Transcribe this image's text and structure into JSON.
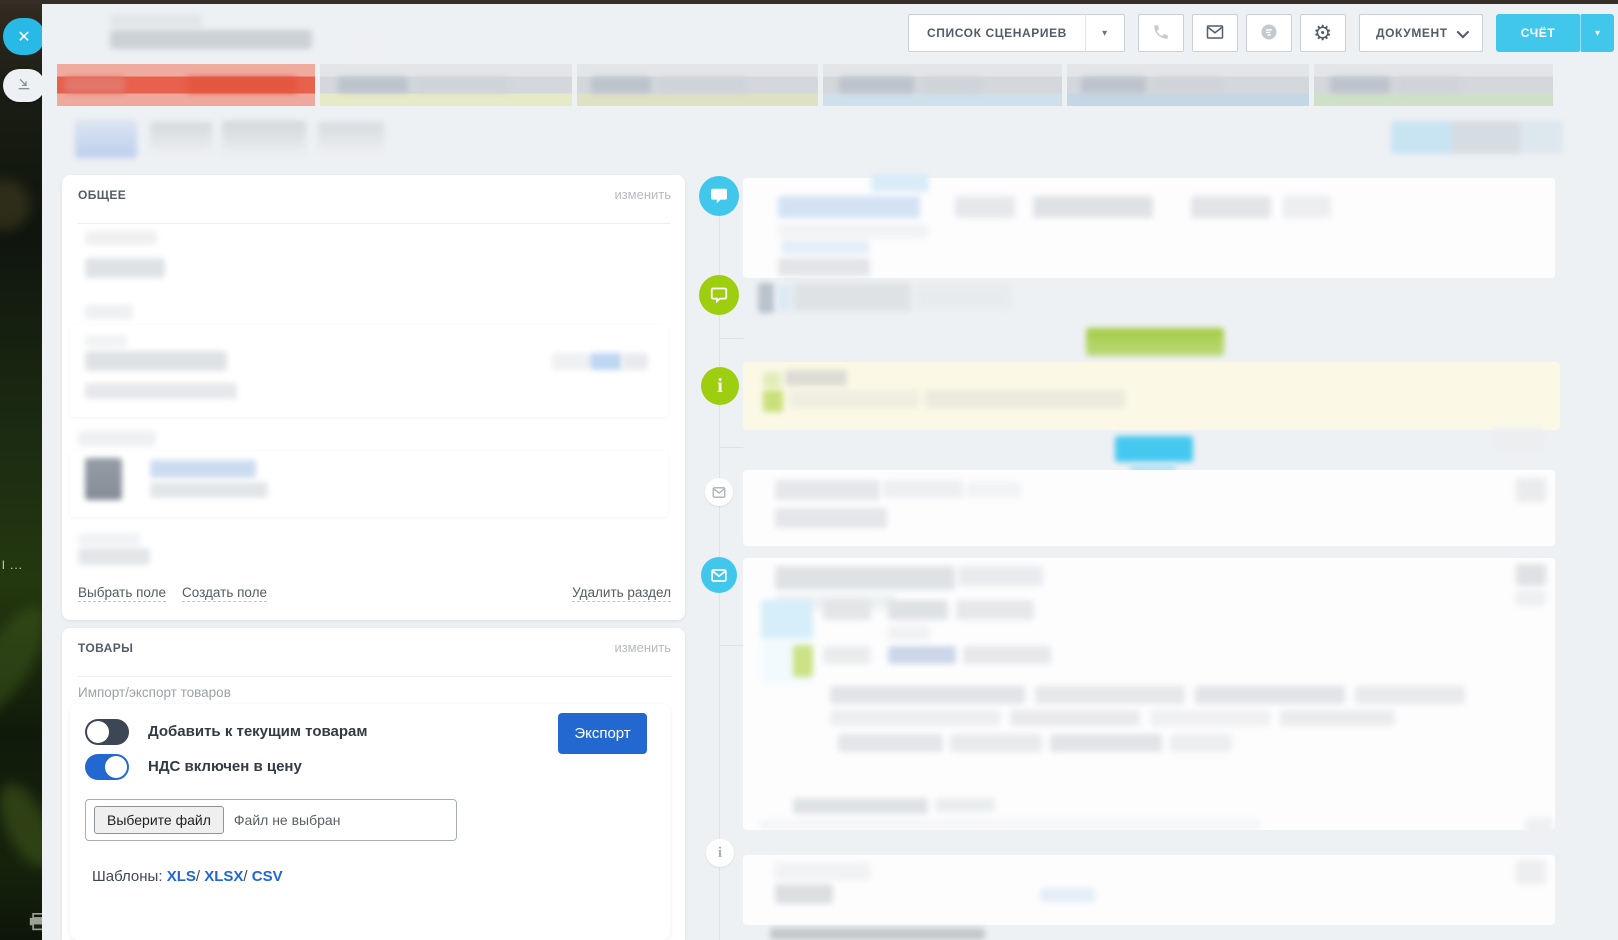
{
  "colors": {
    "page-bg": "#eef1f4",
    "accent-blue": "#2368d1",
    "accent-cyan": "#41c7ec",
    "accent-green": "#9ece10",
    "stage-red": "#e7614d",
    "link-blue": "#2067d6"
  },
  "icons": {
    "close": "✕",
    "dropdown_arrow": "▾",
    "gear": "⚙",
    "info": "i"
  },
  "topbar": {
    "scenario_list_label": "СПИСОК СЦЕНАРИЕВ",
    "document_label": "ДОКУМЕНТ",
    "invoice_label": "СЧЁТ"
  },
  "general_section": {
    "title": "ОБЩЕЕ",
    "edit_label": "изменить",
    "select_field_label": "Выбрать поле",
    "create_field_label": "Создать поле",
    "delete_section_label": "Удалить раздел"
  },
  "products_section": {
    "title": "ТОВАРЫ",
    "edit_label": "изменить",
    "import_export_label": "Импорт/экспорт товаров",
    "toggle_add_label": "Добавить к текущим товарам",
    "toggle_add_state": "off",
    "toggle_vat_label": "НДС включен в цену",
    "toggle_vat_state": "on",
    "export_button_label": "Экспорт",
    "file_button_label": "Выберите файл",
    "file_status_label": "Файл не выбран",
    "templates_label": "Шаблоны:",
    "template_links": [
      "XLS",
      "XLSX",
      "CSV"
    ],
    "template_separator": "/"
  },
  "desktop": {
    "taskbar_text": "l ..."
  }
}
